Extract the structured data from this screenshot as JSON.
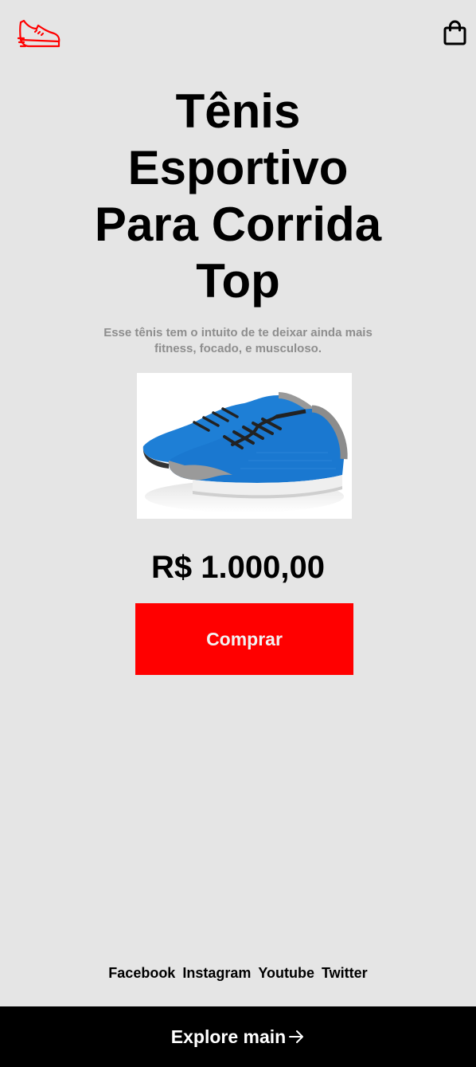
{
  "header": {
    "logo_icon": "running-shoe-icon",
    "cart_icon": "shopping-bag-icon",
    "accent_color": "#ff0000"
  },
  "product": {
    "title": "Tênis Esportivo Para Corrida Top",
    "description": "Esse tênis tem o intuito de te deixar ainda mais fitness, focado, e musculoso.",
    "image": "blue-running-shoes-photo",
    "price": "R$ 1.000,00",
    "buy_label": "Comprar"
  },
  "social": {
    "links": [
      "Facebook",
      "Instagram",
      "Youtube",
      "Twitter"
    ]
  },
  "footer": {
    "explore_label": "Explore main",
    "arrow_icon": "arrow-right-icon"
  },
  "colors": {
    "background": "#e5e5e5",
    "button": "#ff0000",
    "footer": "#000000"
  }
}
